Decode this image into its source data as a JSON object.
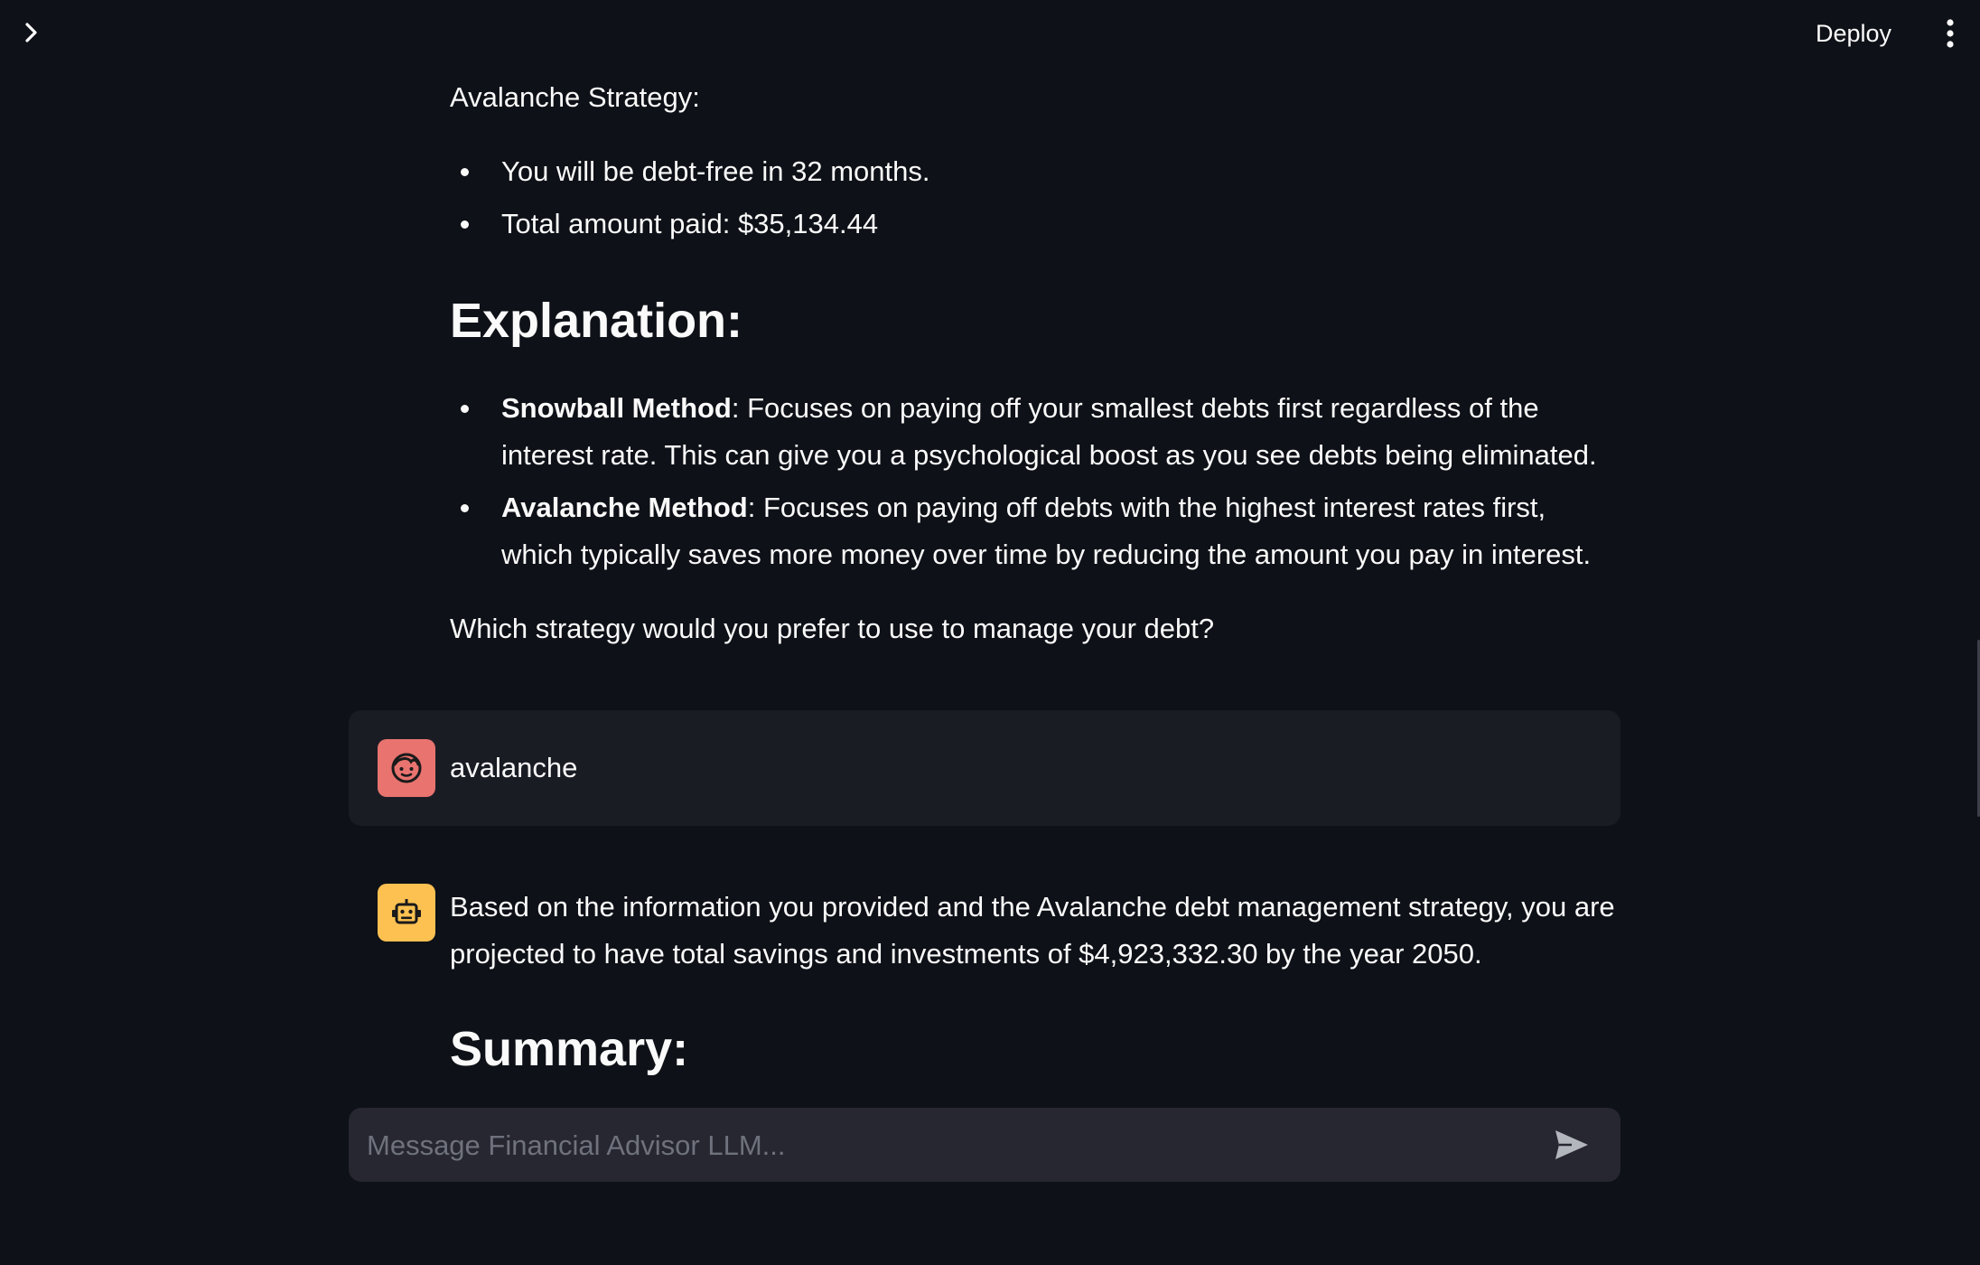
{
  "header": {
    "deploy_label": "Deploy"
  },
  "messages": {
    "assistant_prev": {
      "strategy_heading": "Avalanche Strategy:",
      "strategy_bullets": [
        "You will be debt-free in 32 months.",
        "Total amount paid: $35,134.44"
      ],
      "explanation_heading": "Explanation:",
      "explanation_items": [
        {
          "term": "Snowball Method",
          "text": ": Focuses on paying off your smallest debts first regardless of the interest rate. This can give you a psychological boost as you see debts being eliminated."
        },
        {
          "term": "Avalanche Method",
          "text": ": Focuses on paying off debts with the highest interest rates first, which typically saves more money over time by reducing the amount you pay in interest."
        }
      ],
      "question": "Which strategy would you prefer to use to manage your debt?"
    },
    "user": {
      "text": "avalanche"
    },
    "assistant": {
      "text": "Based on the information you provided and the Avalanche debt management strategy, you are projected to have total savings and investments of $4,923,332.30 by the year 2050.",
      "summary_heading": "Summary:"
    }
  },
  "chat_input": {
    "placeholder": "Message Financial Advisor LLM..."
  },
  "icons": {
    "expand": "chevron-right-icon",
    "menu": "more-vertical-icon",
    "user_avatar": "face-icon",
    "bot_avatar": "robot-icon",
    "send": "send-icon"
  },
  "colors": {
    "background": "#0e1117",
    "user_avatar": "#e8736f",
    "bot_avatar": "#fdc152",
    "user_message_bg": "#1a1c24",
    "input_bg": "#262730"
  }
}
